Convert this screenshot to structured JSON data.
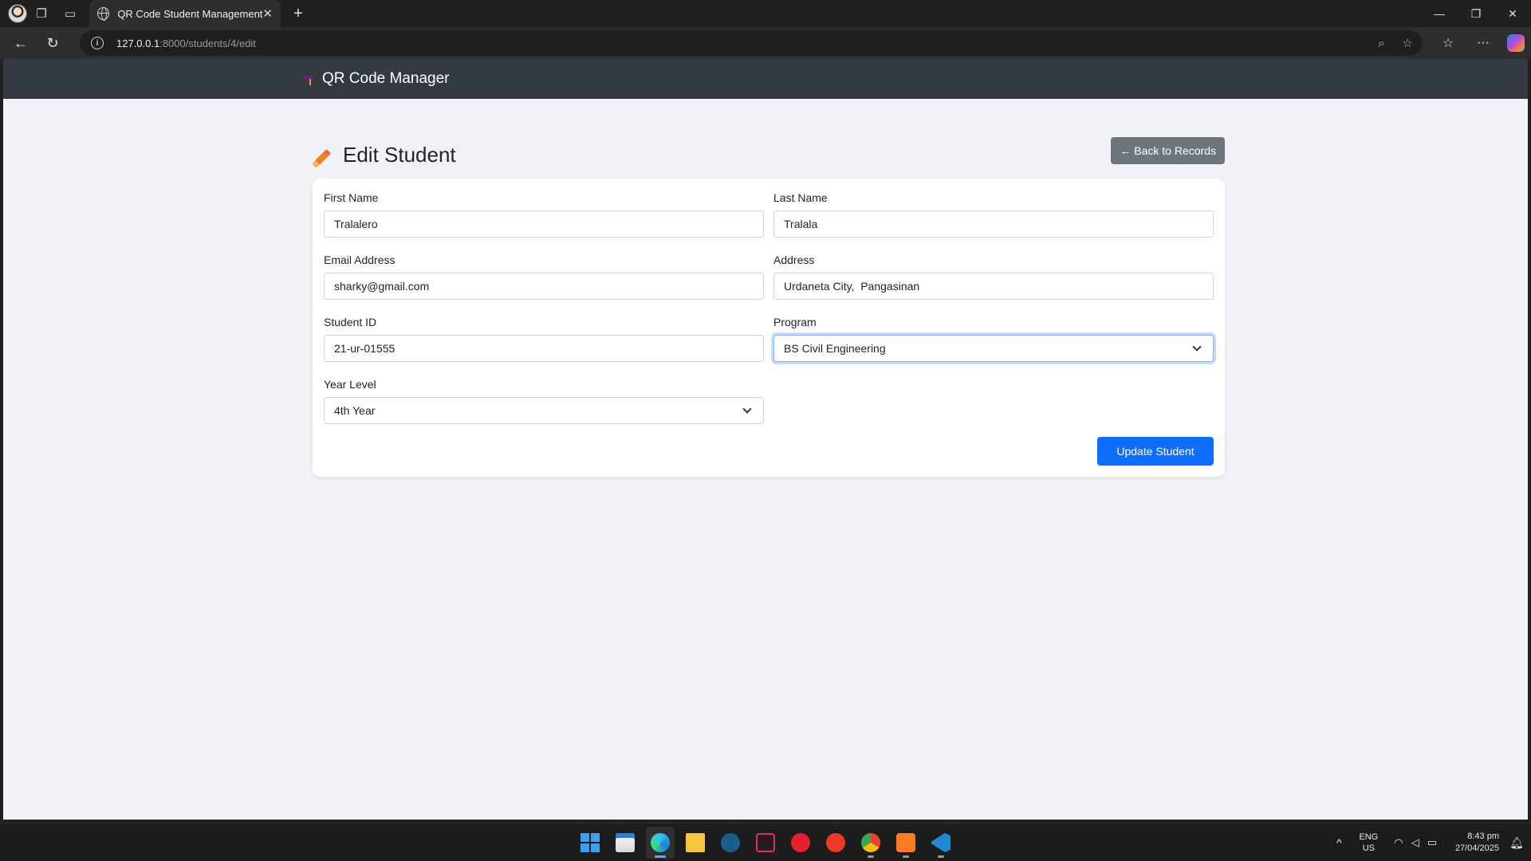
{
  "browser": {
    "tab_title": "QR Code Student Management",
    "url_host": "127.0.0.1",
    "url_rest": ":8000/students/4/edit"
  },
  "app": {
    "brand": "QR Code Manager"
  },
  "page": {
    "title": "Edit Student",
    "back_button": "← Back to Records"
  },
  "form": {
    "first_name": {
      "label": "First Name",
      "value": "Tralalero"
    },
    "last_name": {
      "label": "Last Name",
      "value": "Tralala"
    },
    "email": {
      "label": "Email Address",
      "value": "sharky@gmail.com"
    },
    "address": {
      "label": "Address",
      "value": "Urdaneta City,  Pangasinan"
    },
    "student_id": {
      "label": "Student ID",
      "value": "21-ur-01555"
    },
    "program": {
      "label": "Program",
      "value": "BS Civil Engineering"
    },
    "year_level": {
      "label": "Year Level",
      "value": "4th Year"
    },
    "submit": "Update Student"
  },
  "taskbar": {
    "lang_top": "ENG",
    "lang_bottom": "US",
    "time": "8:43 pm",
    "date": "27/04/2025",
    "apps": [
      "start",
      "microsoft-store",
      "edge",
      "file-explorer",
      "steam",
      "vivaldi",
      "anydesk",
      "wps-office",
      "chrome",
      "xampp",
      "vscode"
    ]
  },
  "colors": {
    "primary": "#0d6efd",
    "secondary": "#6c757d",
    "navbar": "#343a42",
    "page_bg": "#f1f2f5"
  }
}
